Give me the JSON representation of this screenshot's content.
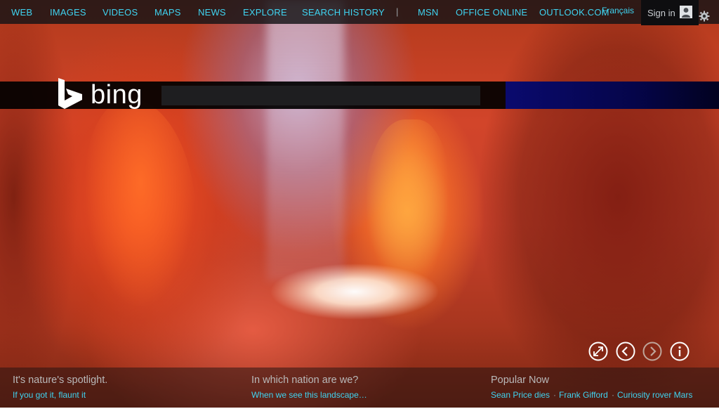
{
  "nav": {
    "items": [
      {
        "label": "WEB"
      },
      {
        "label": "IMAGES"
      },
      {
        "label": "VIDEOS"
      },
      {
        "label": "MAPS"
      },
      {
        "label": "NEWS"
      },
      {
        "label": "EXPLORE"
      },
      {
        "label": "SEARCH HISTORY"
      },
      {
        "label": "MSN"
      },
      {
        "label": "OFFICE ONLINE"
      },
      {
        "label": "OUTLOOK.COM"
      }
    ],
    "divider": "|",
    "language": "Français",
    "sign_in": "Sign in"
  },
  "icons": {
    "user": "user-icon",
    "settings": "gear-icon",
    "fullscreen": "expand-icon",
    "previous": "chevron-left-icon",
    "next": "chevron-right-icon",
    "info": "info-icon"
  },
  "brand": {
    "logo_text": "bing",
    "accent_color": "#3fd3f0",
    "search_accent": "#0a0a6e"
  },
  "search": {
    "value": ""
  },
  "captions": {
    "left": {
      "title": "It's nature's spotlight.",
      "link": "If you got it, flaunt it"
    },
    "middle": {
      "title": "In which nation are we?",
      "link": "When we see this landscape…"
    },
    "right": {
      "title": "Popular Now",
      "separator": "·",
      "links": [
        "Sean Price dies",
        "Frank Gifford",
        "Curiosity rover Mars"
      ]
    }
  }
}
